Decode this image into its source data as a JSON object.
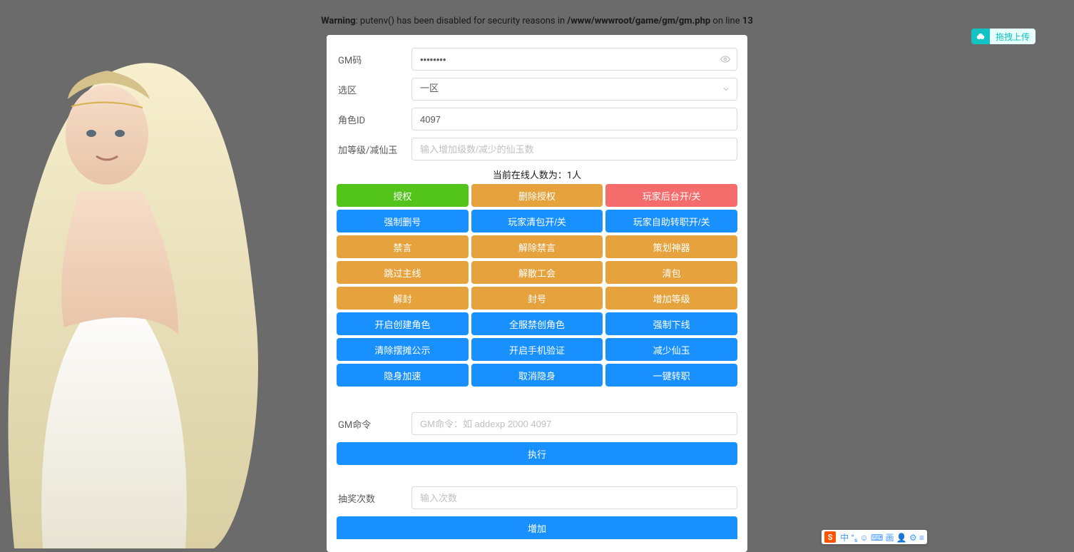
{
  "warning": {
    "prefix_bold": "Warning",
    "middle": ": putenv() has been disabled for security reasons in ",
    "path_bold": "/www/wwwroot/game/gm/gm.php",
    "on_line": " on line ",
    "line_bold": "13"
  },
  "upload_widget": {
    "label": "拖拽上传"
  },
  "form": {
    "gm_code": {
      "label": "GM码",
      "value": "••••••••"
    },
    "zone": {
      "label": "选区",
      "value": "一区"
    },
    "role_id": {
      "label": "角色ID",
      "value": "4097"
    },
    "level": {
      "label": "加等级/减仙玉",
      "placeholder": "输入增加级数/减少的仙玉数"
    },
    "online_status": "当前在线人数为：1人",
    "gm_cmd": {
      "label": "GM命令",
      "placeholder": "GM命令：如 addexp 2000 4097"
    },
    "execute": "执行",
    "lottery": {
      "label": "抽奖次数",
      "placeholder": "输入次数"
    },
    "add": "增加"
  },
  "buttons": [
    {
      "label": "授权",
      "color": "green"
    },
    {
      "label": "删除授权",
      "color": "orange"
    },
    {
      "label": "玩家后台开/关",
      "color": "red"
    },
    {
      "label": "强制删号",
      "color": "blue"
    },
    {
      "label": "玩家清包开/关",
      "color": "blue"
    },
    {
      "label": "玩家自助转职开/关",
      "color": "blue"
    },
    {
      "label": "禁言",
      "color": "orange"
    },
    {
      "label": "解除禁言",
      "color": "orange"
    },
    {
      "label": "策划神器",
      "color": "orange"
    },
    {
      "label": "跳过主线",
      "color": "orange"
    },
    {
      "label": "解散工会",
      "color": "orange"
    },
    {
      "label": "清包",
      "color": "orange"
    },
    {
      "label": "解封",
      "color": "orange"
    },
    {
      "label": "封号",
      "color": "orange"
    },
    {
      "label": "增加等级",
      "color": "orange"
    },
    {
      "label": "开启创建角色",
      "color": "blue"
    },
    {
      "label": "全服禁创角色",
      "color": "blue"
    },
    {
      "label": "强制下线",
      "color": "blue"
    },
    {
      "label": "清除摆摊公示",
      "color": "blue"
    },
    {
      "label": "开启手机验证",
      "color": "blue"
    },
    {
      "label": "减少仙玉",
      "color": "blue"
    },
    {
      "label": "隐身加速",
      "color": "blue"
    },
    {
      "label": "取消隐身",
      "color": "blue"
    },
    {
      "label": "一键转职",
      "color": "blue"
    }
  ],
  "ime": {
    "logo": "S",
    "items": [
      "中",
      "°₅",
      "☺",
      "⌨",
      "画",
      "👤",
      "⚙",
      "≡"
    ]
  }
}
